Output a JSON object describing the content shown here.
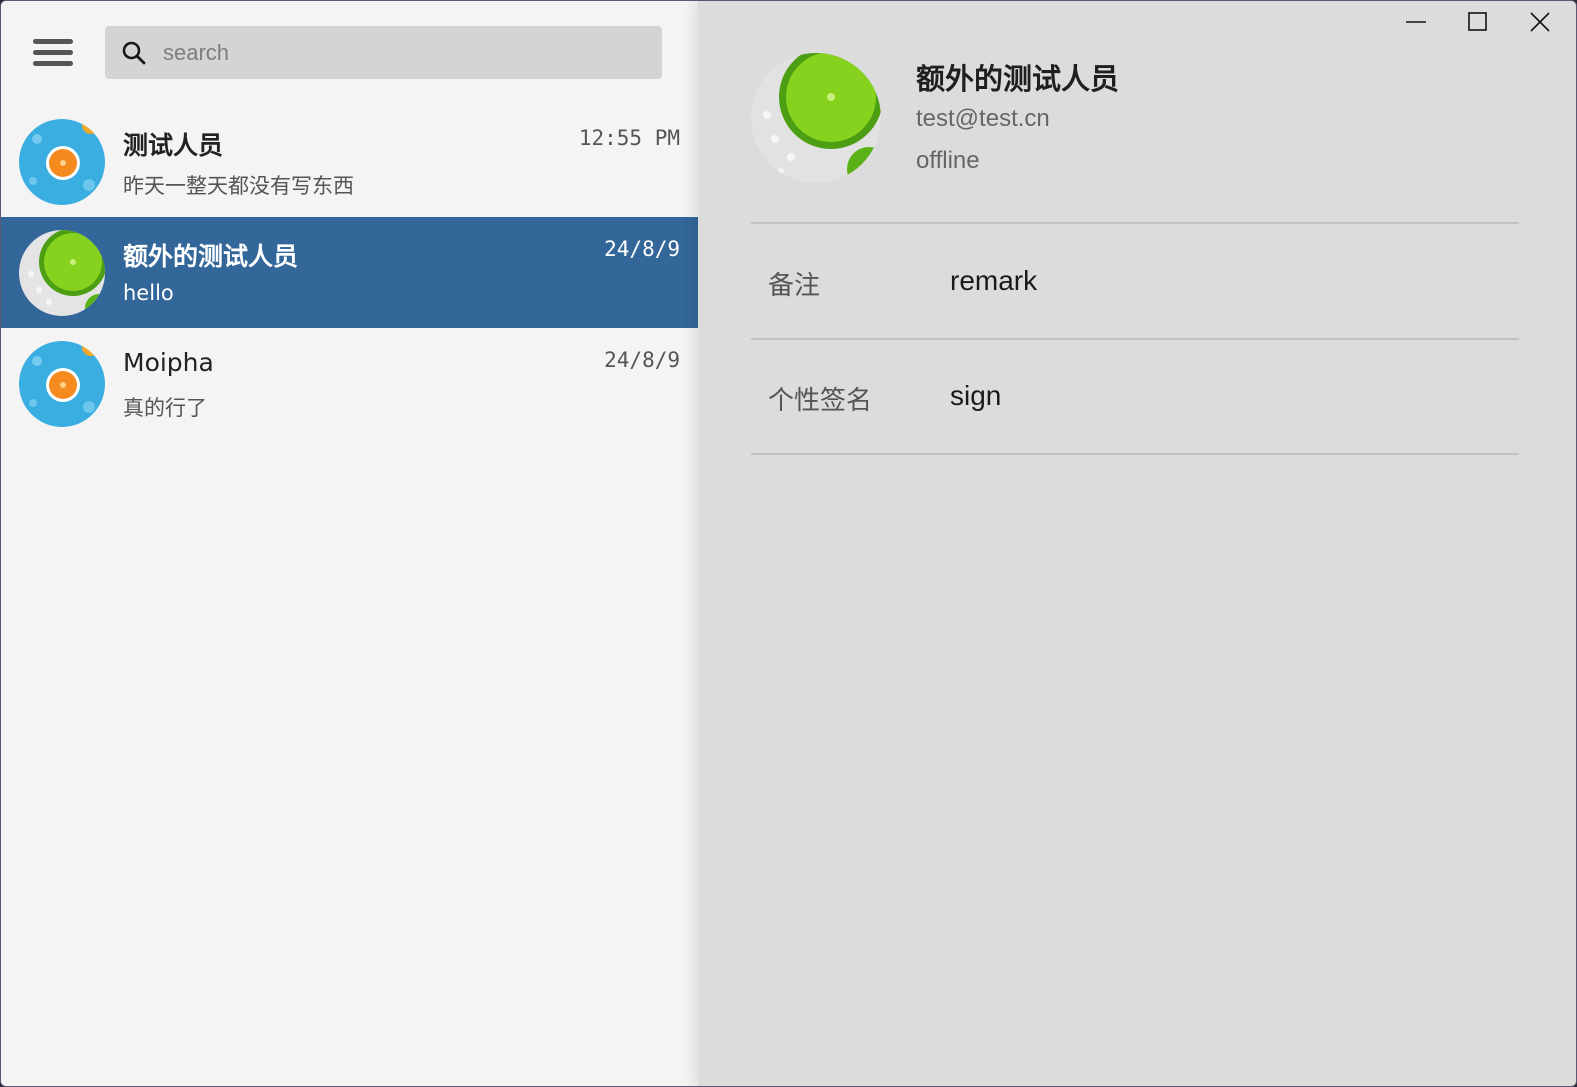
{
  "search": {
    "placeholder": "search"
  },
  "chats": [
    {
      "name": "测试人员",
      "preview": "昨天一整天都没有写东西",
      "time": "12:55 PM",
      "avatar": "orange-avatar",
      "selected": false
    },
    {
      "name": "额外的测试人员",
      "preview": "hello",
      "time": "24/8/9",
      "avatar": "lime-avatar",
      "selected": true
    },
    {
      "name": "Moipha",
      "preview": "真的行了",
      "time": "24/8/9",
      "avatar": "orange-avatar",
      "selected": false
    }
  ],
  "profile": {
    "name": "额外的测试人员",
    "email": "test@test.cn",
    "status": "offline",
    "fields": [
      {
        "label": "备注",
        "value": "remark"
      },
      {
        "label": "个性签名",
        "value": "sign"
      }
    ]
  },
  "colors": {
    "selected_bg": "#336699",
    "left_bg": "#f4f4f4",
    "right_bg": "#dcdcdc",
    "search_bg": "#d4d4d4"
  },
  "icons": [
    "menu-icon",
    "search-icon",
    "minimize-icon",
    "maximize-icon",
    "close-icon"
  ]
}
